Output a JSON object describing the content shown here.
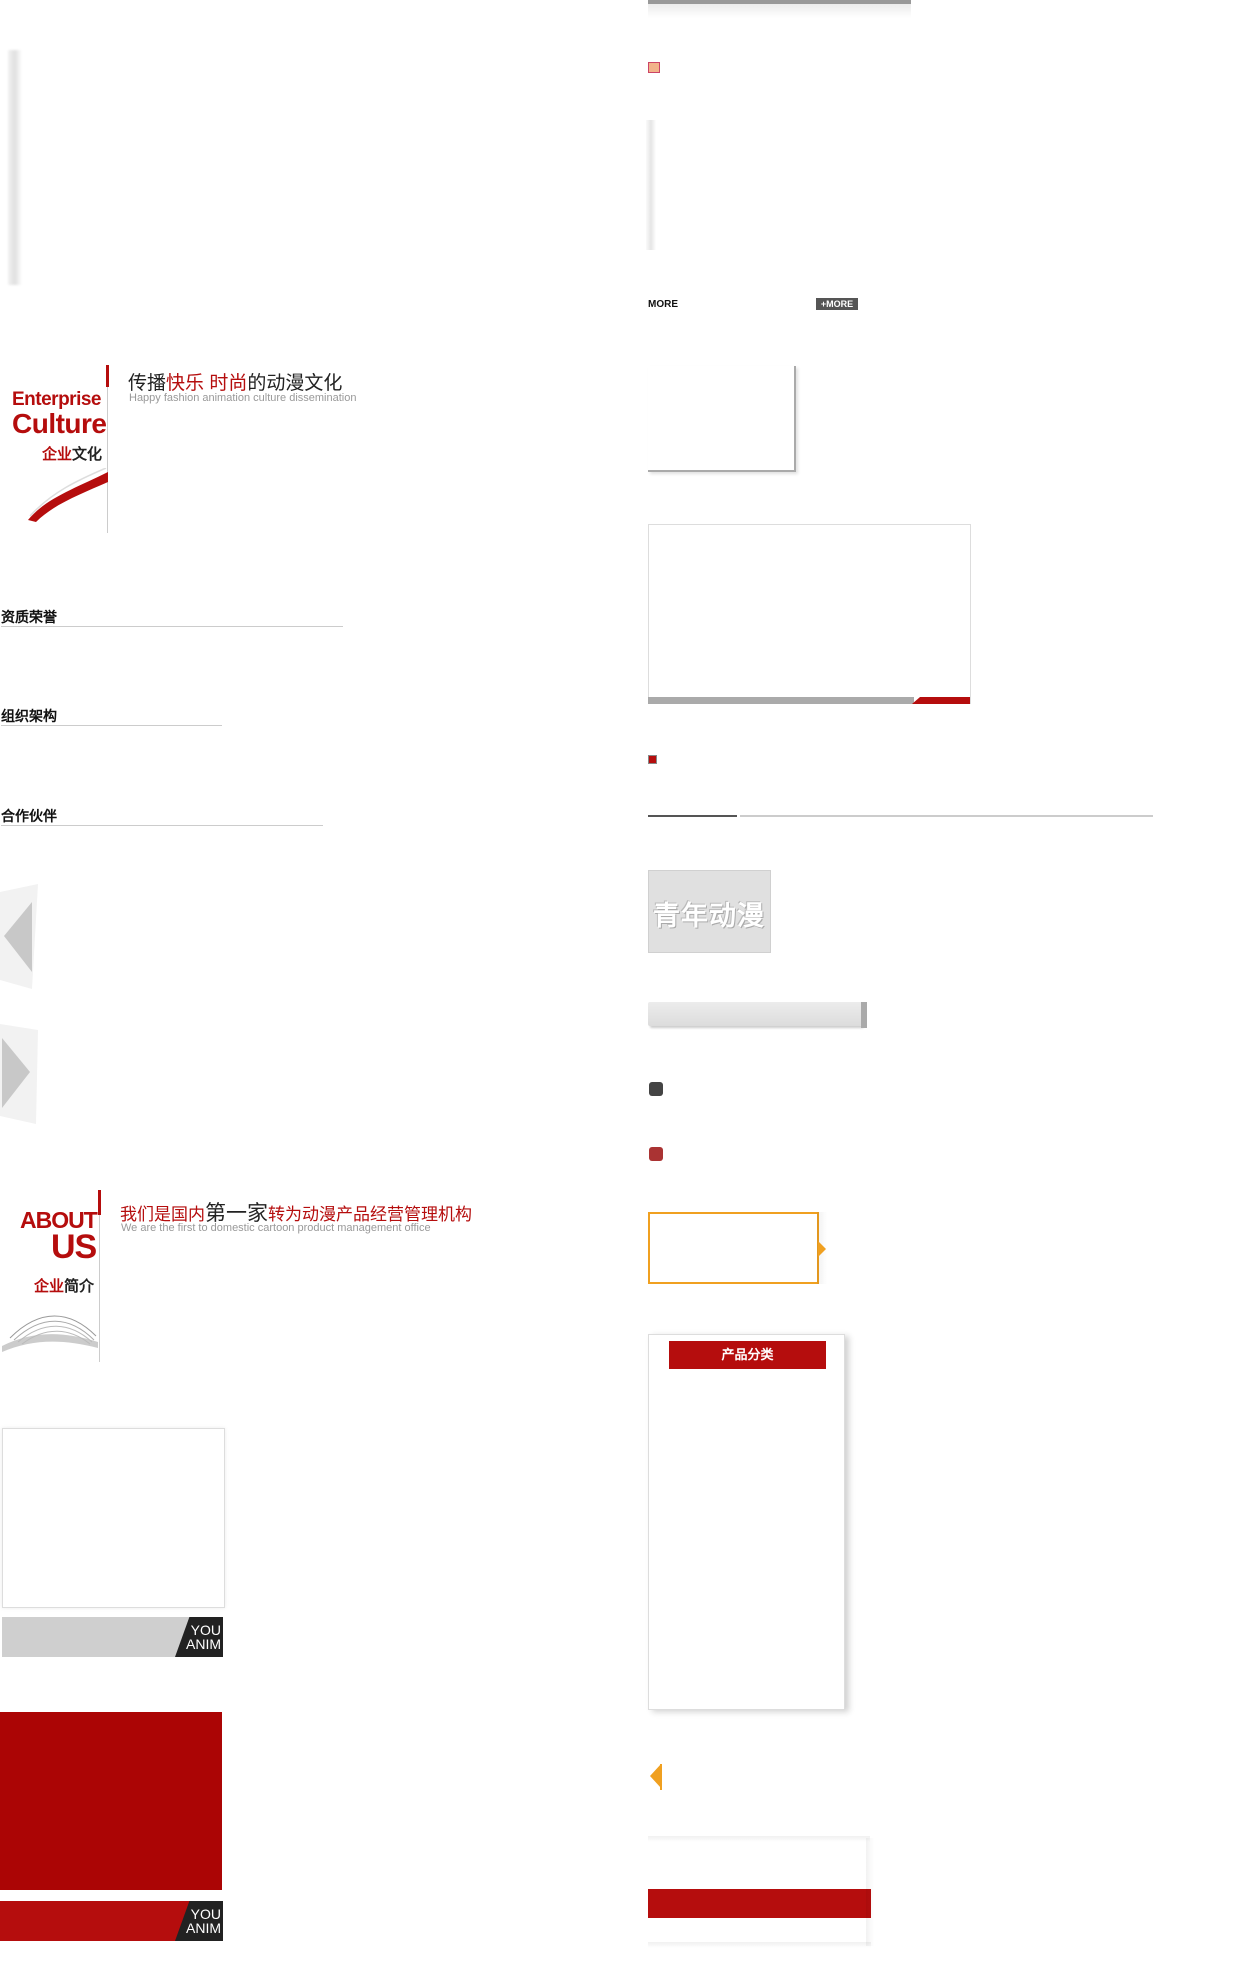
{
  "culture": {
    "en_line1": "Enterprise",
    "en_line2": "Culture",
    "cn_red": "企业",
    "cn_black": "文化",
    "slogan_pre": "传播",
    "slogan_red1": "快乐",
    "slogan_red2": "时尚",
    "slogan_post": "的动漫文化",
    "subtitle": "Happy fashion animation culture dissemination"
  },
  "sections": {
    "honors": "资质荣誉",
    "structure": "组织架构",
    "partners": "合作伙伴"
  },
  "about": {
    "en_line1": "ABOUT",
    "en_line2": "US",
    "cn_red": "企业",
    "cn_black": "简介",
    "slogan_pre": "我们是国内",
    "slogan_big": "第一家",
    "slogan_post": "转为动漫产品经营管理机构",
    "subtitle": "We are the first to domestic cartoon product management office"
  },
  "banners": {
    "grey_line1": "YOU",
    "grey_line2": "ANIM",
    "red_line1": "YOU",
    "red_line2": "ANIM"
  },
  "right": {
    "more_label": "MORE",
    "more_button": "+MORE",
    "logo_text": "青年动漫",
    "category_title": "产品分类"
  },
  "colors": {
    "brand_red": "#b50d0d",
    "accent_orange": "#f0a020"
  }
}
